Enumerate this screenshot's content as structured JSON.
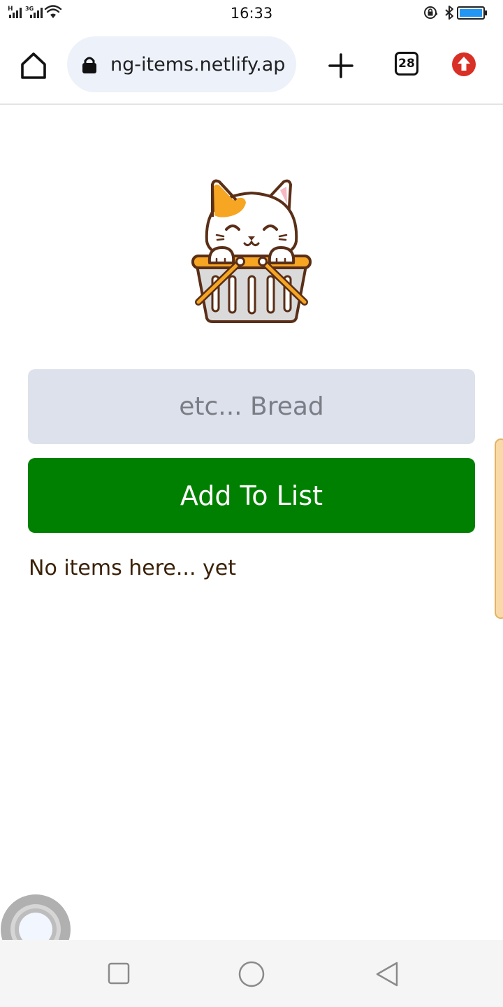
{
  "status_bar": {
    "time": "16:33",
    "sim1_label": "H",
    "sim2_label": "3G",
    "icons": [
      "signal-icon",
      "wifi-icon",
      "rotation-lock-icon",
      "bluetooth-icon",
      "battery-icon"
    ]
  },
  "browser": {
    "url": "ng-items.netlify.app",
    "tab_count": "28",
    "icons": [
      "home-icon",
      "lock-icon",
      "plus-icon",
      "update-arrow-icon"
    ],
    "accent_color": "#d93025"
  },
  "app": {
    "input_placeholder": "etc... Bread",
    "add_button_label": "Add To List",
    "empty_message": "No items here... yet",
    "button_color": "#008000",
    "input_background": "#dde1eb"
  },
  "nav_bar": {
    "icons": [
      "recents-icon",
      "home-circle-icon",
      "back-icon"
    ]
  }
}
